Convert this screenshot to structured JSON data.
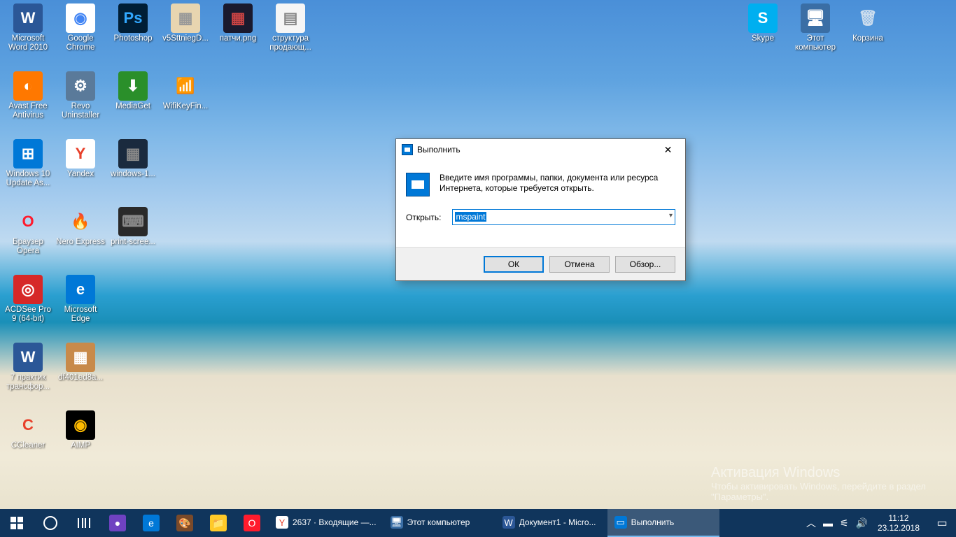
{
  "desktop": {
    "icons": [
      {
        "id": "word",
        "label": "Microsoft Word 2010",
        "col": 0,
        "row": 0,
        "bg": "#2b5797",
        "fg": "#fff",
        "letter": "W"
      },
      {
        "id": "chrome",
        "label": "Google Chrome",
        "col": 1,
        "row": 0,
        "bg": "#fff",
        "fg": "#4285f4",
        "letter": "◉"
      },
      {
        "id": "photoshop",
        "label": "Photoshop",
        "col": 2,
        "row": 0,
        "bg": "#001e36",
        "fg": "#31a8ff",
        "letter": "Ps"
      },
      {
        "id": "img1",
        "label": "v5SttniegD...",
        "col": 3,
        "row": 0,
        "bg": "#e8d5b0",
        "fg": "#999",
        "letter": "▦"
      },
      {
        "id": "img2",
        "label": "патчи.png",
        "col": 4,
        "row": 0,
        "bg": "#1a1a2e",
        "fg": "#c44",
        "letter": "▦"
      },
      {
        "id": "img3",
        "label": "структура продающ...",
        "col": 5,
        "row": 0,
        "bg": "#f5f5f5",
        "fg": "#888",
        "letter": "▤"
      },
      {
        "id": "skype",
        "label": "Skype",
        "col": 14,
        "row": 0,
        "bg": "#00aff0",
        "fg": "#fff",
        "letter": "S"
      },
      {
        "id": "thispc",
        "label": "Этот компьютер",
        "col": 15,
        "row": 0,
        "bg": "#3a6ea5",
        "fg": "#fff",
        "letter": "🖥"
      },
      {
        "id": "recycle",
        "label": "Корзина",
        "col": 16,
        "row": 0,
        "bg": "transparent",
        "fg": "#cde",
        "letter": "🗑"
      },
      {
        "id": "avast",
        "label": "Avast Free Antivirus",
        "col": 0,
        "row": 1,
        "bg": "#ff7800",
        "fg": "#fff",
        "letter": "◐"
      },
      {
        "id": "revo",
        "label": "Revo Uninstaller",
        "col": 1,
        "row": 1,
        "bg": "#5a7a9a",
        "fg": "#fff",
        "letter": "⚙"
      },
      {
        "id": "mediaget",
        "label": "MediaGet",
        "col": 2,
        "row": 1,
        "bg": "#2a8f2a",
        "fg": "#fff",
        "letter": "⬇"
      },
      {
        "id": "wifikey",
        "label": "WifiKeyFin...",
        "col": 3,
        "row": 1,
        "bg": "transparent",
        "fg": "#ffcc00",
        "letter": "📶"
      },
      {
        "id": "winupdate",
        "label": "Windows 10 Update As...",
        "col": 0,
        "row": 2,
        "bg": "#0078d7",
        "fg": "#fff",
        "letter": "⊞"
      },
      {
        "id": "yandex",
        "label": "Yandex",
        "col": 1,
        "row": 2,
        "bg": "#fff",
        "fg": "#e8402a",
        "letter": "Y"
      },
      {
        "id": "winsnap",
        "label": "windows-1...",
        "col": 2,
        "row": 2,
        "bg": "#1a2a3e",
        "fg": "#888",
        "letter": "▦"
      },
      {
        "id": "opera",
        "label": "Браузер Opera",
        "col": 0,
        "row": 3,
        "bg": "transparent",
        "fg": "#ff1b2d",
        "letter": "O"
      },
      {
        "id": "nero",
        "label": "Nero Express",
        "col": 1,
        "row": 3,
        "bg": "transparent",
        "fg": "#ff6600",
        "letter": "🔥"
      },
      {
        "id": "printscreen",
        "label": "print-scree...",
        "col": 2,
        "row": 3,
        "bg": "#2a2a2a",
        "fg": "#888",
        "letter": "⌨"
      },
      {
        "id": "acdsee",
        "label": "ACDSee Pro 9 (64-bit)",
        "col": 0,
        "row": 4,
        "bg": "#d62828",
        "fg": "#fff",
        "letter": "◎"
      },
      {
        "id": "edge",
        "label": "Microsoft Edge",
        "col": 1,
        "row": 4,
        "bg": "#0078d7",
        "fg": "#fff",
        "letter": "e"
      },
      {
        "id": "doc7",
        "label": "7 практик трансфор...",
        "col": 0,
        "row": 5,
        "bg": "#2b5797",
        "fg": "#fff",
        "letter": "W"
      },
      {
        "id": "df401",
        "label": "df401ed8a...",
        "col": 1,
        "row": 5,
        "bg": "#c88a4a",
        "fg": "#fff",
        "letter": "▦"
      },
      {
        "id": "ccleaner",
        "label": "CCleaner",
        "col": 0,
        "row": 6,
        "bg": "transparent",
        "fg": "#e8402a",
        "letter": "C"
      },
      {
        "id": "aimp",
        "label": "AIMP",
        "col": 1,
        "row": 6,
        "bg": "#000",
        "fg": "#ffbb00",
        "letter": "◉"
      }
    ]
  },
  "watermark": {
    "title": "Активация Windows",
    "subtitle": "Чтобы активировать Windows, перейдите в раздел \"Параметры\"."
  },
  "run": {
    "title": "Выполнить",
    "description": "Введите имя программы, папки, документа или ресурса Интернета, которые требуется открыть.",
    "fieldLabel": "Открыть:",
    "value": "mspaint",
    "ok": "ОК",
    "cancel": "Отмена",
    "browse": "Обзор..."
  },
  "taskbar": {
    "tasks": [
      {
        "id": "yandex-mail",
        "label": "2637 · Входящие —...",
        "bg": "#fff",
        "fg": "#e8402a",
        "letter": "Y",
        "active": false
      },
      {
        "id": "thispc-task",
        "label": "Этот компьютер",
        "bg": "#3a6ea5",
        "fg": "#fff",
        "letter": "🖥",
        "active": false
      },
      {
        "id": "word-task",
        "label": "Документ1 - Micro...",
        "bg": "#2b5797",
        "fg": "#fff",
        "letter": "W",
        "active": false
      },
      {
        "id": "run-task",
        "label": "Выполнить",
        "bg": "#0078d7",
        "fg": "#fff",
        "letter": "▭",
        "active": true
      }
    ],
    "pinned": [
      {
        "id": "cortana-orb",
        "bg": "#6f42c1",
        "letter": "●"
      },
      {
        "id": "edge-pin",
        "bg": "#0078d7",
        "letter": "e"
      },
      {
        "id": "paint-pin",
        "bg": "#7a4a2a",
        "letter": "🎨"
      },
      {
        "id": "explorer-pin",
        "bg": "#ffca28",
        "letter": "📁"
      },
      {
        "id": "opera-pin",
        "bg": "#ff1b2d",
        "letter": "O"
      }
    ],
    "clock": {
      "time": "11:12",
      "date": "23.12.2018"
    }
  }
}
